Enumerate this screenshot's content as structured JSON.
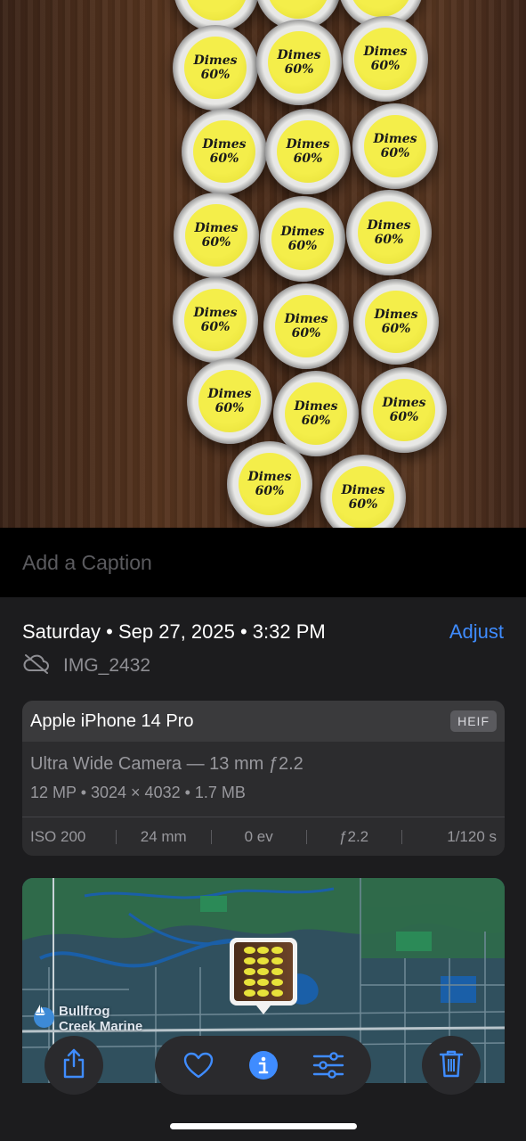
{
  "photo": {
    "label_line1": "Dimes",
    "label_line2": "60%"
  },
  "caption": {
    "placeholder": "Add a Caption"
  },
  "info": {
    "datetime": "Saturday • Sep 27, 2025 • 3:32 PM",
    "adjust_label": "Adjust",
    "filename": "IMG_2432",
    "cloud_icon": "cloud-slash-icon"
  },
  "camera_card": {
    "device": "Apple iPhone 14 Pro",
    "format_badge": "HEIF",
    "lens": "Ultra Wide Camera — 13 mm ƒ2.2",
    "specs": "12 MP • 3024 × 4032 • 1.7 MB",
    "exif": [
      "ISO 200",
      "24 mm",
      "0 ev",
      "ƒ2.2",
      "1/120 s"
    ]
  },
  "map": {
    "place_name_line1": "Bullfrog",
    "place_name_line2": "Creek Marine",
    "place_icon": "sailboat-icon"
  },
  "toolbar": {
    "icons": [
      "share-icon",
      "heart-icon",
      "info-icon",
      "adjust-sliders-icon",
      "trash-icon"
    ],
    "accent_color": "#3f8cff"
  }
}
